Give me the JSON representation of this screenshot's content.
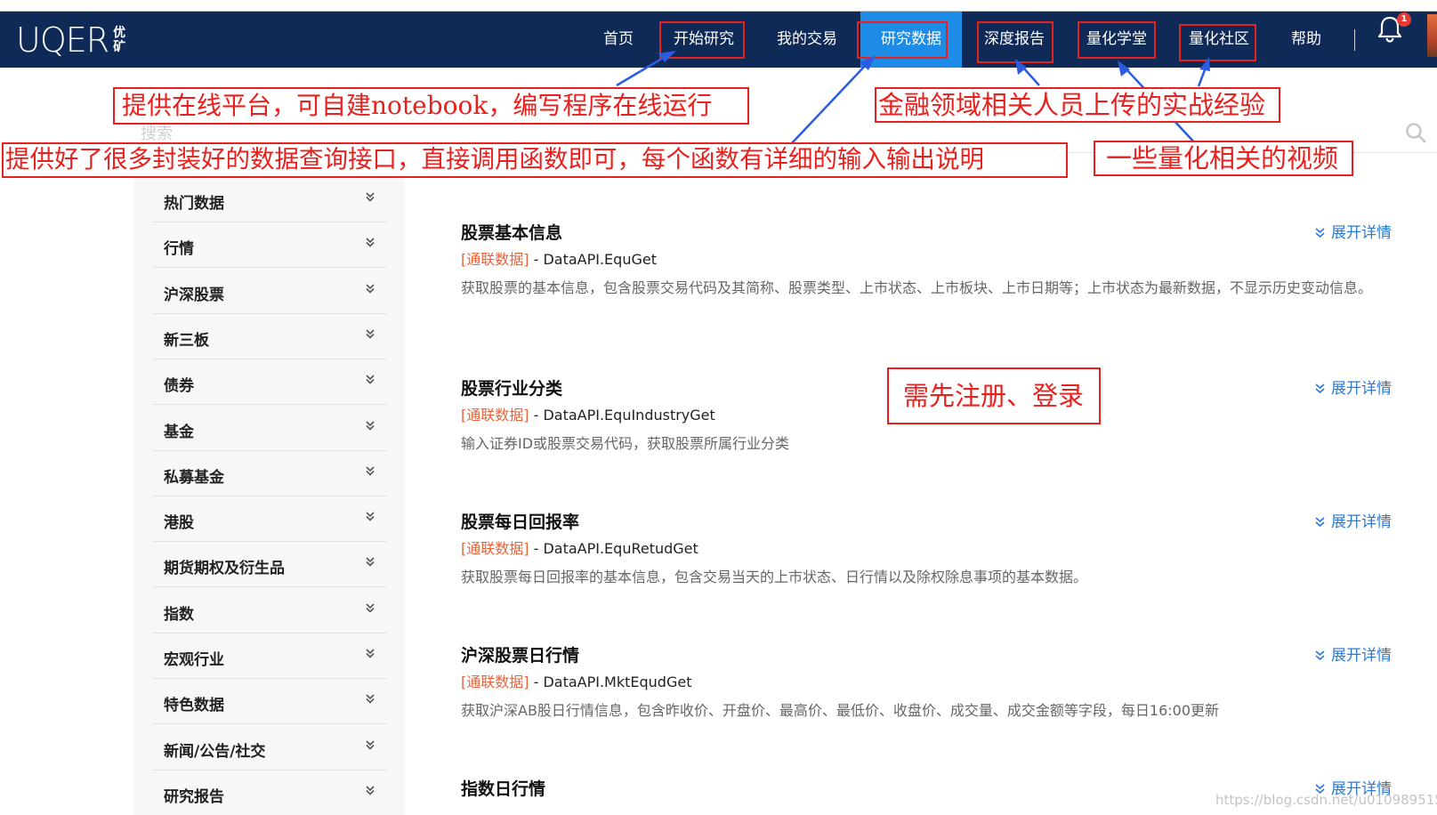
{
  "logo": {
    "main": "UQER",
    "sub_top": "优",
    "sub_bottom": "矿"
  },
  "nav": [
    {
      "label": "首页"
    },
    {
      "label": "开始研究"
    },
    {
      "label": "我的交易"
    },
    {
      "label": "研究数据",
      "active": true
    },
    {
      "label": "深度报告"
    },
    {
      "label": "量化学堂"
    },
    {
      "label": "量化社区"
    },
    {
      "label": "帮助"
    }
  ],
  "notifications": {
    "count": "1"
  },
  "search": {
    "placeholder": "搜索"
  },
  "sidebar": {
    "items": [
      {
        "label": "热门数据"
      },
      {
        "label": "行情"
      },
      {
        "label": "沪深股票"
      },
      {
        "label": "新三板"
      },
      {
        "label": "债券"
      },
      {
        "label": "基金"
      },
      {
        "label": "私募基金"
      },
      {
        "label": "港股"
      },
      {
        "label": "期货期权及衍生品"
      },
      {
        "label": "指数"
      },
      {
        "label": "宏观行业"
      },
      {
        "label": "特色数据"
      },
      {
        "label": "新闻/公告/社交"
      },
      {
        "label": "研究报告"
      }
    ]
  },
  "datasets": [
    {
      "title": "股票基本信息",
      "source": "[通联数据]",
      "api": " - DataAPI.EquGet",
      "desc": "获取股票的基本信息，包含股票交易代码及其简称、股票类型、上市状态、上市板块、上市日期等；上市状态为最新数据，不显示历史变动信息。",
      "expand": "展开详情"
    },
    {
      "title": "股票行业分类",
      "source": "[通联数据]",
      "api": " - DataAPI.EquIndustryGet",
      "desc": "输入证券ID或股票交易代码，获取股票所属行业分类",
      "expand": "展开详情"
    },
    {
      "title": "股票每日回报率",
      "source": "[通联数据]",
      "api": " - DataAPI.EquRetudGet",
      "desc": "获取股票每日回报率的基本信息，包含交易当天的上市状态、日行情以及除权除息事项的基本数据。",
      "expand": "展开详情"
    },
    {
      "title": "沪深股票日行情",
      "source": "[通联数据]",
      "api": " - DataAPI.MktEqudGet",
      "desc": "获取沪深AB股日行情信息，包含昨收价、开盘价、最高价、最低价、收盘价、成交量、成交金额等字段，每日16:00更新",
      "expand": "展开详情"
    },
    {
      "title": "指数日行情",
      "source": "",
      "api": "",
      "desc": "",
      "expand": "展开详情"
    }
  ],
  "annotations": {
    "notebook": "提供在线平台，可自建notebook，编写程序在线运行",
    "data_api": "提供好了很多封装好的数据查询接口，直接调用函数即可，每个函数有详细的输入输出说明",
    "reports": "金融领域相关人员上传的实战经验",
    "videos": "一些量化相关的视频",
    "login": "需先注册、登录"
  },
  "watermark": "https://blog.csdn.net/u010989515",
  "colors": {
    "navbar": "#0f2a57",
    "active_nav": "#1e8ce6",
    "annotation": "#e8201e",
    "source_tag": "#e8643c",
    "link": "#2a7ad6"
  }
}
